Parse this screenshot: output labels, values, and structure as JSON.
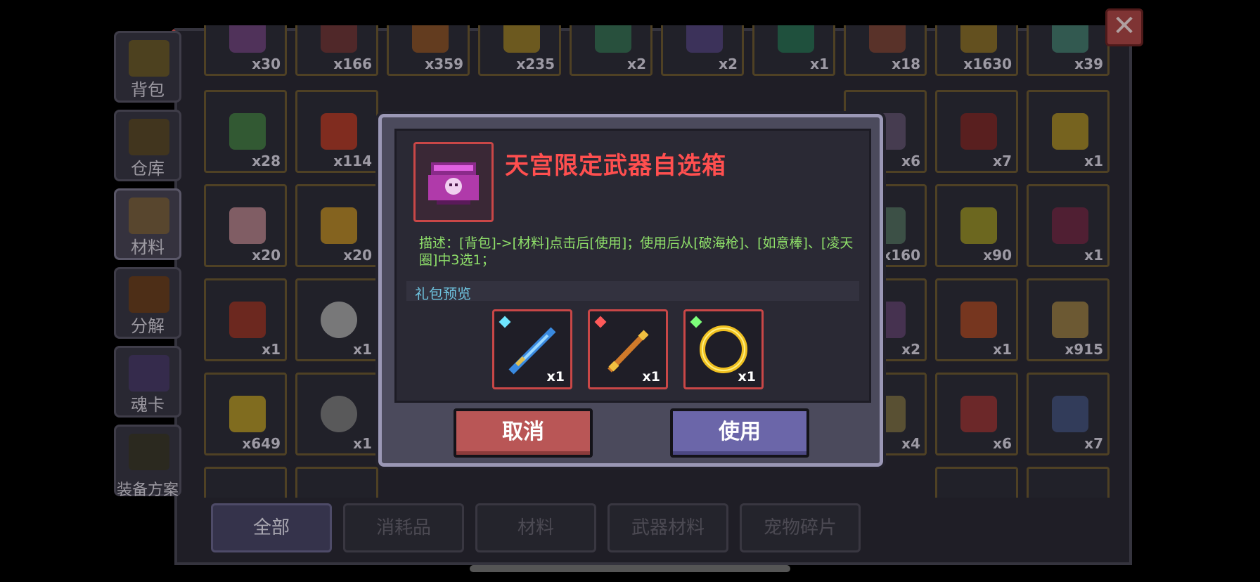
{
  "sidebar": {
    "tabs": [
      {
        "label": "背包",
        "active": false
      },
      {
        "label": "仓库",
        "active": false
      },
      {
        "label": "材料",
        "active": true
      },
      {
        "label": "分解",
        "active": false
      },
      {
        "label": "魂卡",
        "active": false
      },
      {
        "label": "装备方案",
        "active": false
      }
    ]
  },
  "bottom_tabs": [
    {
      "label": "全部",
      "active": true
    },
    {
      "label": "消耗品",
      "active": false
    },
    {
      "label": "材料",
      "active": false
    },
    {
      "label": "武器材料",
      "active": false
    },
    {
      "label": "宠物碎片",
      "active": false
    }
  ],
  "grid": {
    "row1": [
      "x30",
      "x166",
      "x359",
      "x235",
      "x2",
      "x2",
      "x1",
      "x18",
      "x1630",
      "x39"
    ],
    "row2_left": [
      "x28",
      "x114"
    ],
    "row2_right": [
      "x6",
      "x7",
      "x1"
    ],
    "row3_left": [
      "x20",
      "x20"
    ],
    "row3_right": [
      "x160",
      "x90",
      "x1"
    ],
    "row4_left": [
      "x1",
      "x1"
    ],
    "row4_right": [
      "x2",
      "x1",
      "x915"
    ],
    "row5_left": [
      "x649",
      "x1"
    ],
    "row5_right": [
      "x4",
      "x6",
      "x7"
    ]
  },
  "dialog": {
    "title": "天宫限定武器自选箱",
    "description": "描述：[背包]->[材料]点击后[使用]；使用后从[破海枪]、[如意棒]、[凌天圈]中3选1；",
    "preview_label": "礼包预览",
    "rewards": [
      {
        "icon": "spear-icon",
        "qty": "x1",
        "gem_color": "#6fe6ff"
      },
      {
        "icon": "staff-icon",
        "qty": "x1",
        "gem_color": "#ff5a5a"
      },
      {
        "icon": "ring-icon",
        "qty": "x1",
        "gem_color": "#7dff7a"
      }
    ],
    "cancel_label": "取消",
    "use_label": "使用"
  },
  "colors": {
    "title_red": "#ff4f4f",
    "desc_green": "#8fe06a",
    "preview_blue": "#6fc4e0",
    "cancel_red": "#b95656",
    "use_purple": "#6b66a9"
  }
}
